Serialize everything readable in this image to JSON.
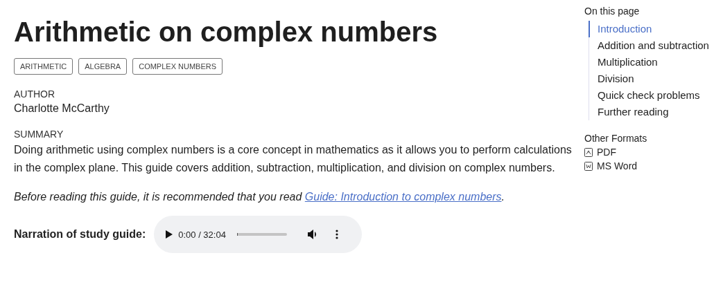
{
  "title": "Arithmetic on complex numbers",
  "tags": [
    "ARITHMETIC",
    "ALGEBRA",
    "COMPLEX NUMBERS"
  ],
  "author": {
    "label": "AUTHOR",
    "value": "Charlotte McCarthy"
  },
  "summary": {
    "label": "SUMMARY",
    "text": "Doing arithmetic using complex numbers is a core concept in mathematics as it allows you to perform calculations in the complex plane. This guide covers addition, subtraction, multiplication, and division on complex numbers."
  },
  "note": {
    "before": "Before reading this guide, it is recommended that you read ",
    "link": "Guide: Introduction to complex numbers",
    "after": "."
  },
  "audio": {
    "label": "Narration of study guide:",
    "time": "0:00 / 32:04",
    "level": 0
  },
  "toc": {
    "title": "On this page",
    "items": [
      {
        "label": "Introduction",
        "selected": true
      },
      {
        "label": "Addition and subtraction",
        "selected": false
      },
      {
        "label": "Multiplication",
        "selected": false
      },
      {
        "label": "Division",
        "selected": false
      },
      {
        "label": "Quick check problems",
        "selected": false
      },
      {
        "label": "Further reading",
        "selected": false
      }
    ]
  },
  "formats": {
    "title": "Other Formats",
    "items": [
      {
        "kind": "pdf",
        "label": "PDF"
      },
      {
        "kind": "word",
        "label": "MS Word"
      }
    ]
  }
}
